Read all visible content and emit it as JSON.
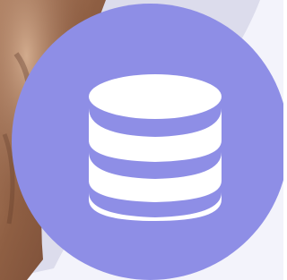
{
  "scene": {
    "background_color": "#f3f3fb",
    "backdrop_image": "person-photo-backdrop",
    "swoosh_color": "#dcdcec"
  },
  "badge": {
    "icon": "database-icon",
    "color": "#8e8ee6",
    "icon_color": "#ffffff"
  }
}
